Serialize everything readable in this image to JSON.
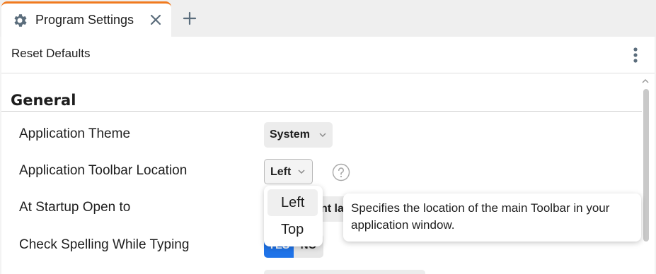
{
  "tab": {
    "title": "Program Settings",
    "icon": "gear-icon",
    "close_icon": "close-icon",
    "new_tab_icon": "plus-icon",
    "accent": "#f07a1f"
  },
  "toolbar": {
    "reset_label": "Reset Defaults",
    "more_icon": "more-vertical-icon"
  },
  "section": {
    "title": "General"
  },
  "settings": [
    {
      "label": "Application Theme",
      "value": "System"
    },
    {
      "label": "Application Toolbar Location",
      "value": "Left"
    },
    {
      "label": "At Startup Open to",
      "value": "nt la"
    },
    {
      "label": "Check Spelling While Typing",
      "yes": "YES",
      "no": "NO",
      "selected": "YES"
    }
  ],
  "dropdown": {
    "options": [
      "Left",
      "Top"
    ],
    "highlighted": "Left"
  },
  "tooltip": {
    "line1": "Specifies the location of the main Toolbar in your",
    "line2": "application window."
  },
  "colors": {
    "primary": "#1f73e8"
  }
}
